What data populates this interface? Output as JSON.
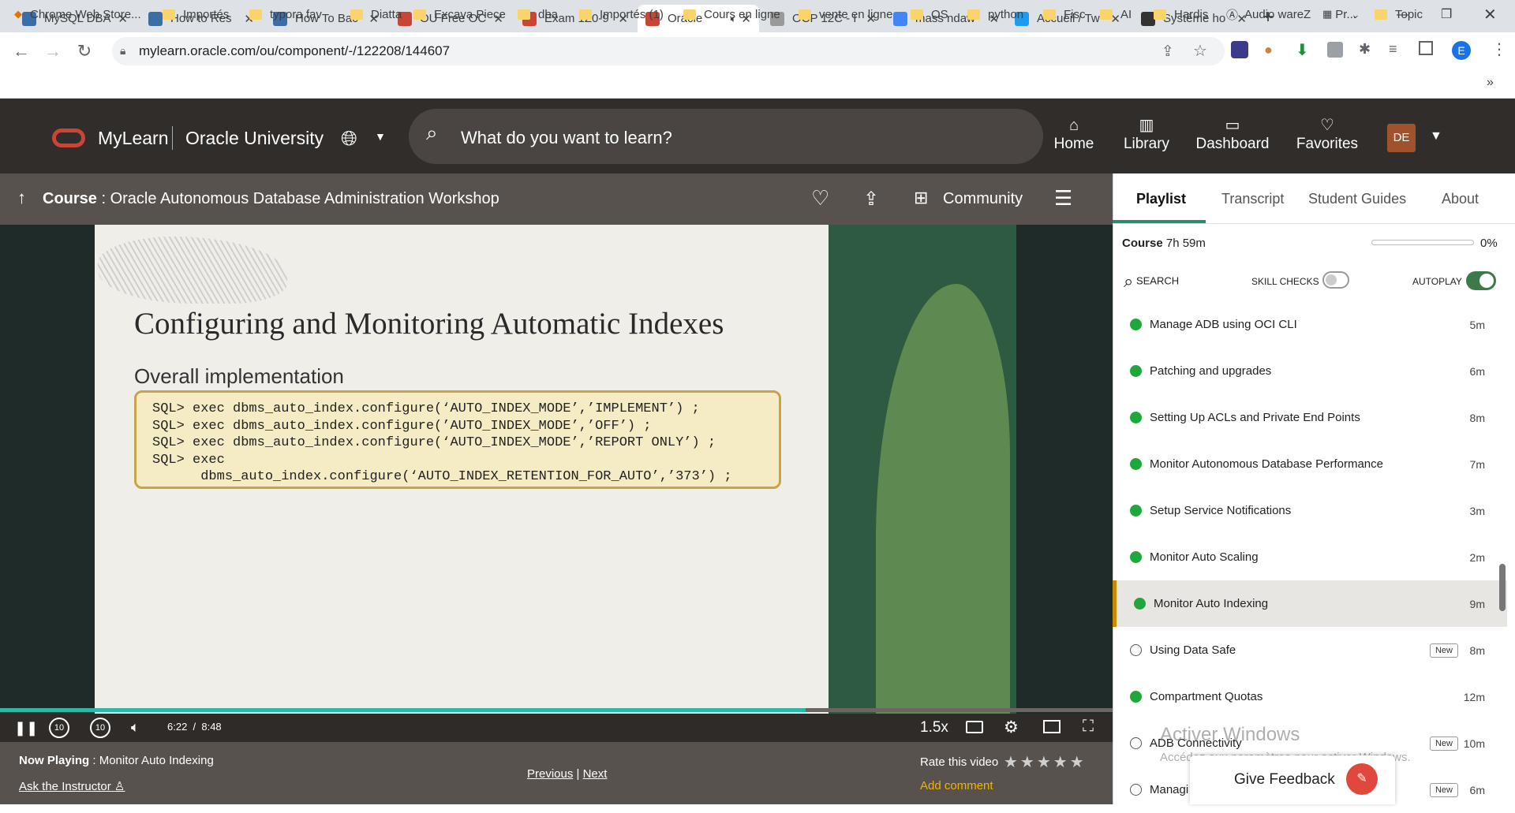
{
  "browser": {
    "tabs": [
      {
        "title": "MySQL DBA",
        "color": "#3b6ea5"
      },
      {
        "title": "How to Res",
        "color": "#3b6ea5"
      },
      {
        "title": "How To Bac",
        "color": "#3b6ea5"
      },
      {
        "title": "OU Free OC",
        "color": "#c74634"
      },
      {
        "title": "Exam 1Z0-9",
        "color": "#c74634"
      },
      {
        "title": "Oracle",
        "color": "#c74634"
      },
      {
        "title": "OCP 12C - I",
        "color": "#999999"
      },
      {
        "title": "mass ndaw",
        "color": "#4285f4"
      },
      {
        "title": "Accueil / Tw",
        "color": "#1d9bf0"
      },
      {
        "title": "Système ho",
        "color": "#333333"
      }
    ],
    "url": "mylearn.oracle.com/ou/component/-/122208/144607",
    "profile_initial": "E",
    "bookmarks": [
      "Chrome Web Store...",
      "Importés",
      "typora fav",
      "Diatta",
      "Excava Piece",
      "dba",
      "Importés (1)",
      "Cours en ligne",
      "vente en ligne",
      "OS",
      "python",
      "Fisc",
      "AI",
      "Hardis",
      "Audio wareZ",
      "Pr...",
      "Topic"
    ],
    "bookmarks_more": "»"
  },
  "site": {
    "brand": "MyLearn",
    "org": "Oracle University",
    "search_placeholder": "What do you want to learn?",
    "nav": [
      "Home",
      "Library",
      "Dashboard",
      "Favorites"
    ],
    "user_initials": "DE"
  },
  "course": {
    "label": "Course",
    "sep": " : ",
    "title": "Oracle Autonomous Database Administration Workshop",
    "community": "Community"
  },
  "slide": {
    "title": "Configuring and Monitoring Automatic Indexes",
    "subtitle": "Overall implementation",
    "code": [
      "SQL> exec dbms_auto_index.configure(‘AUTO_INDEX_MODE’,’IMPLEMENT’) ;",
      "SQL> exec dbms_auto_index.configure(’AUTO_INDEX_MODE’,’OFF’) ;",
      "SQL> exec dbms_auto_index.configure(‘AUTO_INDEX_MODE’,’REPORT ONLY’) ;",
      "SQL> exec",
      "      dbms_auto_index.configure(‘AUTO_INDEX_RETENTION_FOR_AUTO’,’373’) ;"
    ]
  },
  "player": {
    "time": "6:22  /  8:48",
    "progress": 0.724,
    "speed": "1.5x",
    "skip": "10"
  },
  "now_playing": {
    "label": "Now Playing",
    "sep": " : ",
    "title": "Monitor Auto Indexing",
    "ask": "Ask the Instructor",
    "previous": "Previous",
    "divider": " | ",
    "next": "Next",
    "rate": "Rate this video",
    "comment": "Add comment"
  },
  "sidebar": {
    "tabs": [
      "Playlist",
      "Transcript",
      "Student Guides",
      "About"
    ],
    "course_label": "Course",
    "course_duration": "7h 59m",
    "course_progress": "0%",
    "search": "SEARCH",
    "skill_checks": "SKILL CHECKS",
    "autoplay": "AUTOPLAY",
    "items": [
      {
        "title": "Manage ADB using OCI CLI",
        "dur": "5m",
        "done": true,
        "new": ""
      },
      {
        "title": "Patching and upgrades",
        "dur": "6m",
        "done": true,
        "new": ""
      },
      {
        "title": "Setting Up ACLs and Private End Points",
        "dur": "8m",
        "done": true,
        "new": ""
      },
      {
        "title": "Monitor Autonomous Database Performance",
        "dur": "7m",
        "done": true,
        "new": ""
      },
      {
        "title": "Setup Service Notifications",
        "dur": "3m",
        "done": true,
        "new": ""
      },
      {
        "title": "Monitor Auto Scaling",
        "dur": "2m",
        "done": true,
        "new": ""
      },
      {
        "title": "Monitor Auto Indexing",
        "dur": "9m",
        "done": true,
        "new": ""
      },
      {
        "title": "Using Data Safe",
        "dur": "8m",
        "done": false,
        "new": "New"
      },
      {
        "title": "Compartment Quotas",
        "dur": "12m",
        "done": true,
        "new": ""
      },
      {
        "title": "ADB Connectivity",
        "dur": "10m",
        "done": false,
        "new": "New"
      },
      {
        "title": "Managi",
        "dur": "6m",
        "done": false,
        "new": "New"
      }
    ],
    "feedback": "Give Feedback"
  },
  "watermark": {
    "line1": "Activer Windows",
    "line2": "Accédez aux paramètres pour activer Windows."
  }
}
